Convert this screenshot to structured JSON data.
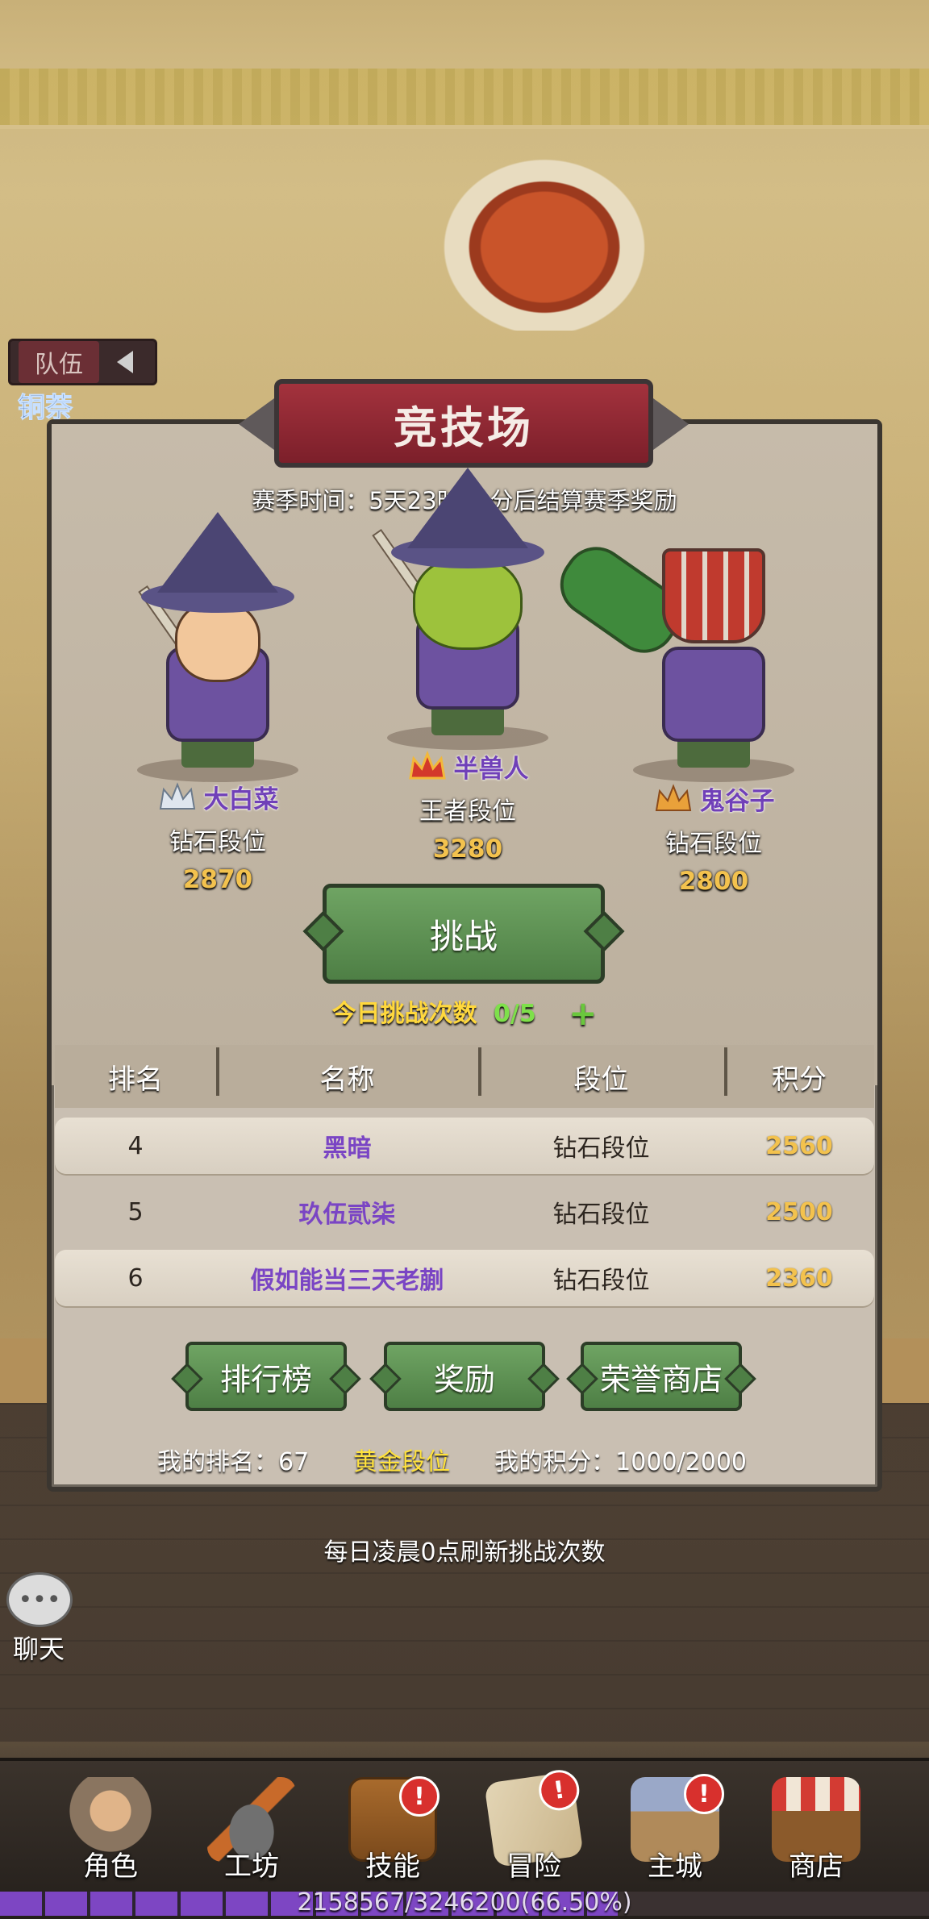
{
  "background": {
    "sand_color": "#c9b37d",
    "fort_color": "#c9542a"
  },
  "side": {
    "team_tab_label": "队伍",
    "clipped_label": "铜萘"
  },
  "arena": {
    "title": "竞技场",
    "season_text": "赛季时间：5天23时11分后结算赛季奖励",
    "heroes": [
      {
        "name": "大白菜",
        "rank": "钻石段位",
        "score": "2870",
        "crown_icon": "silver-crown-icon"
      },
      {
        "name": "半兽人",
        "rank": "王者段位",
        "score": "3280",
        "crown_icon": "red-crown-icon"
      },
      {
        "name": "鬼谷子",
        "rank": "钻石段位",
        "score": "2800",
        "crown_icon": "gold-crown-icon"
      }
    ],
    "challenge_label": "挑战",
    "daily_label": "今日挑战次数",
    "daily_count": "0/5",
    "daily_plus": "+",
    "table": {
      "headers": [
        "排名",
        "名称",
        "段位",
        "积分"
      ],
      "rows": [
        {
          "rank": "4",
          "name": "黑暗",
          "tier": "钻石段位",
          "score": "2560"
        },
        {
          "rank": "5",
          "name": "玖伍贰柒",
          "tier": "钻石段位",
          "score": "2500"
        },
        {
          "rank": "6",
          "name": "假如能当三天老蒯",
          "tier": "钻石段位",
          "score": "2360"
        }
      ]
    },
    "buttons": {
      "leaderboard": "排行榜",
      "rewards": "奖励",
      "honor_shop": "荣誉商店"
    },
    "my_rank": "我的排名：67",
    "my_tier": "黄金段位",
    "my_points": "我的积分：1000/2000",
    "refresh_note": "每日凌晨0点刷新挑战次数"
  },
  "chat": {
    "label": "聊天",
    "icon": "chat-bubble-icon"
  },
  "nav": [
    {
      "label": "角色",
      "icon": "character-icon",
      "badge": ""
    },
    {
      "label": "工坊",
      "icon": "workshop-icon",
      "badge": ""
    },
    {
      "label": "技能",
      "icon": "skill-book-icon",
      "badge": "!"
    },
    {
      "label": "冒险",
      "icon": "adventure-map-icon",
      "badge": "!"
    },
    {
      "label": "主城",
      "icon": "main-city-icon",
      "badge": "!"
    },
    {
      "label": "商店",
      "icon": "shop-icon",
      "badge": ""
    }
  ],
  "xp": {
    "text": "2158567/3246200(66.50%)",
    "progress_percent": 66.5,
    "fill_color": "#7d46c3"
  }
}
